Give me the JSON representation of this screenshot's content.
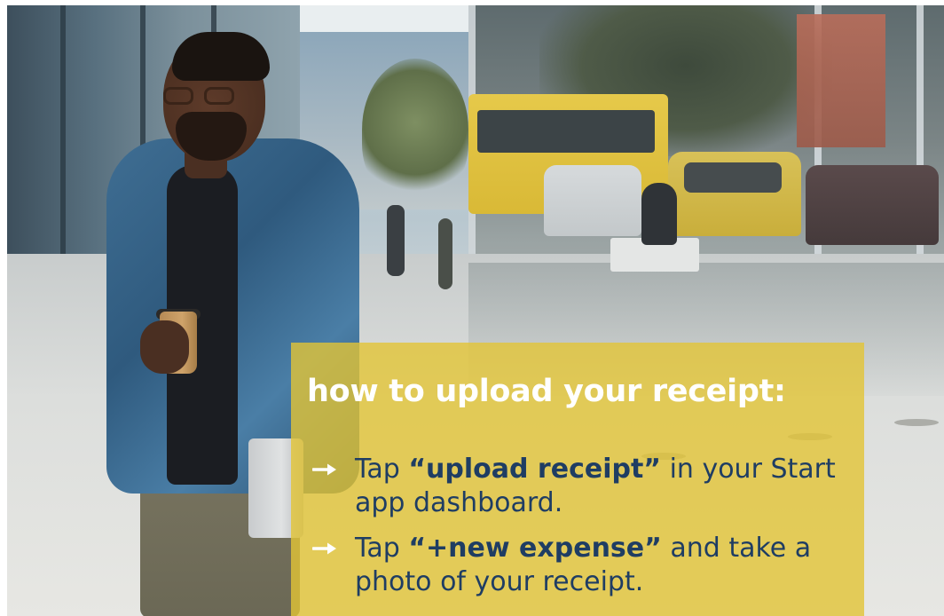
{
  "panel": {
    "title": "how to upload your receipt:",
    "steps": [
      {
        "before": "Tap ",
        "bold": "“upload receipt”",
        "after": " in your Start app dashboard."
      },
      {
        "before": "Tap ",
        "bold": "“+new expense”",
        "after": " and take a photo of your receipt."
      }
    ],
    "panel_color": "#e2c436",
    "title_color": "#ffffff",
    "text_color": "#1f3d63"
  },
  "scene": {
    "icons": [
      "arrow-right-icon"
    ]
  }
}
